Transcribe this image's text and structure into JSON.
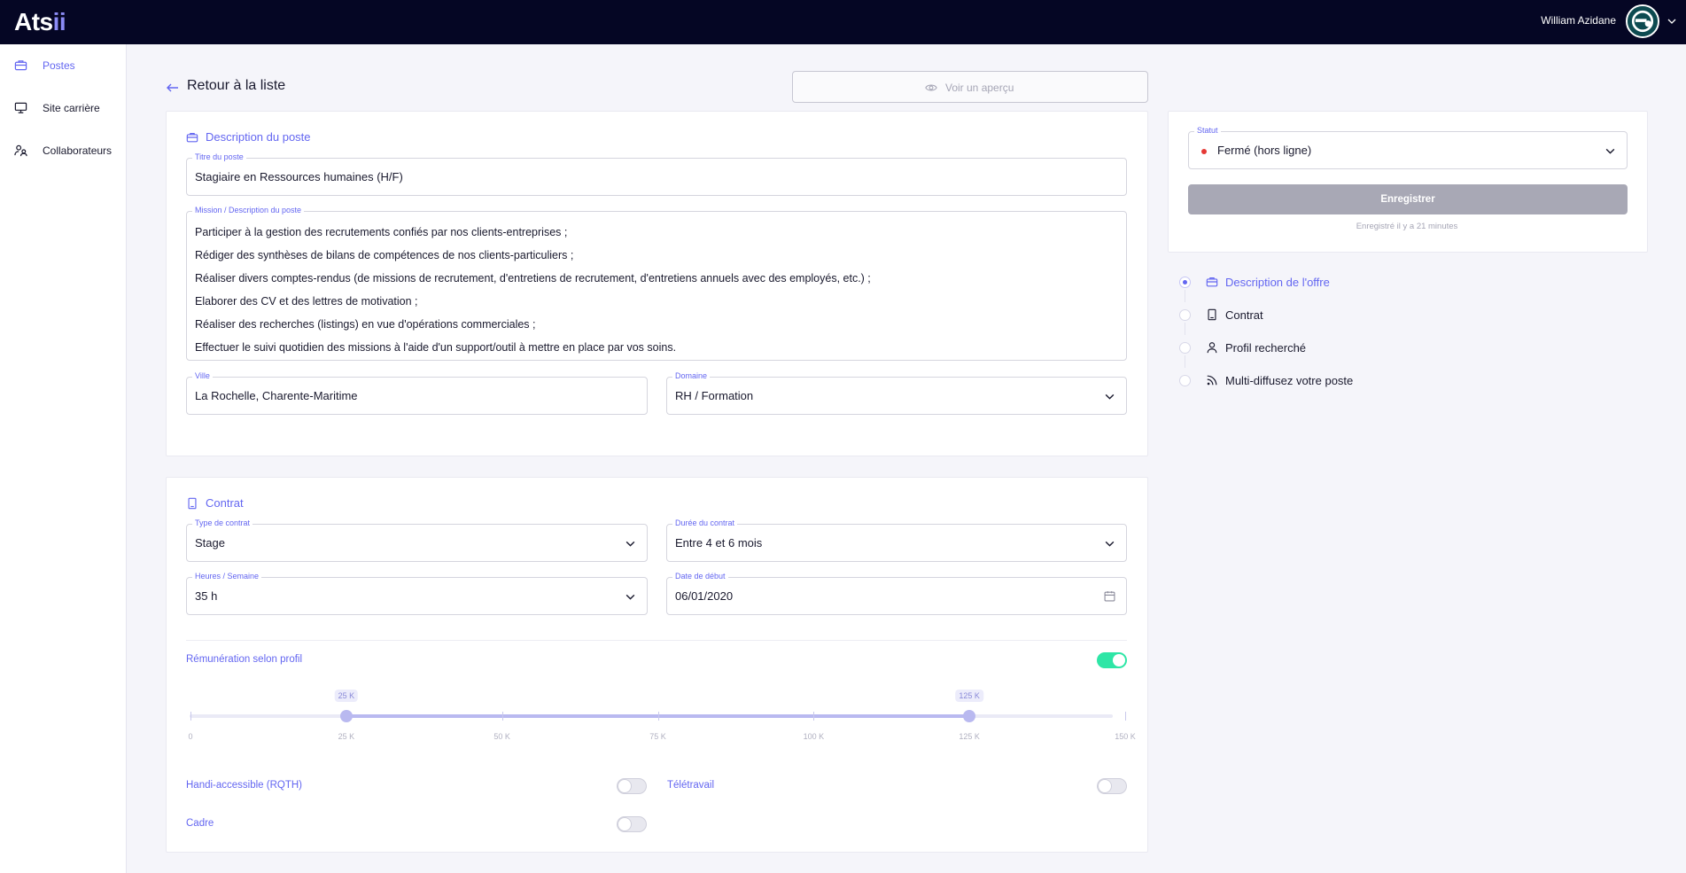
{
  "app": {
    "logo_main": "Ats",
    "logo_accent": "ii"
  },
  "user": {
    "name": "William Azidane"
  },
  "sidebar": {
    "items": [
      {
        "label": "Postes",
        "icon": "briefcase-icon",
        "active": true
      },
      {
        "label": "Site carrière",
        "icon": "monitor-icon",
        "active": false
      },
      {
        "label": "Collaborateurs",
        "icon": "users-icon",
        "active": false
      }
    ]
  },
  "header": {
    "back_label": "Retour à la liste",
    "preview_label": "Voir un aperçu"
  },
  "description": {
    "title": "Description du poste",
    "job_title_label": "Titre du poste",
    "job_title_value": "Stagiaire en Ressources humaines (H/F)",
    "mission_label": "Mission / Description du poste",
    "mission_lines": [
      "Participer à la gestion des recrutements confiés par nos clients-entreprises ;",
      "Rédiger des synthèses de bilans de compétences de nos clients-particuliers ;",
      "Réaliser divers comptes-rendus (de missions de recrutement, d'entretiens de recrutement, d'entretiens annuels avec des employés, etc.) ;",
      "Elaborer des CV et des lettres de motivation ;",
      "Réaliser des recherches (listings) en vue d'opérations commerciales ;",
      "Effectuer le suivi quotidien des missions à l'aide d'un support/outil à mettre en place par vos soins."
    ],
    "city_label": "Ville",
    "city_value": "La Rochelle, Charente-Maritime",
    "domain_label": "Domaine",
    "domain_value": "RH / Formation"
  },
  "contract": {
    "title": "Contrat",
    "type_label": "Type de contrat",
    "type_value": "Stage",
    "duration_label": "Durée du contrat",
    "duration_value": "Entre 4 et 6 mois",
    "hours_label": "Heures / Semaine",
    "hours_value": "35 h",
    "start_label": "Date de début",
    "start_value": "06/01/2020",
    "salary_label": "Rémunération selon profil",
    "salary_toggle_on": true,
    "salary_range": {
      "min": 0,
      "max": 150,
      "low": 25,
      "high": 125,
      "low_label": "25 K",
      "high_label": "125 K",
      "ticks": [
        {
          "value": 0,
          "label": "0"
        },
        {
          "value": 25,
          "label": "25 K"
        },
        {
          "value": 50,
          "label": "50 K"
        },
        {
          "value": 75,
          "label": "75 K"
        },
        {
          "value": 100,
          "label": "100 K"
        },
        {
          "value": 125,
          "label": "125 K"
        },
        {
          "value": 150,
          "label": "150 K"
        }
      ]
    },
    "handi_label": "Handi-accessible (RQTH)",
    "handi_on": false,
    "remote_label": "Télétravail",
    "remote_on": false,
    "cadre_label": "Cadre",
    "cadre_on": false
  },
  "status_panel": {
    "status_label": "Statut",
    "status_value": "Fermé (hors ligne)",
    "status_color": "#e53935",
    "save_label": "Enregistrer",
    "saved_note": "Enregistré il y a 21 minutes"
  },
  "steps": [
    {
      "label": "Description de l'offre",
      "icon": "briefcase-icon",
      "active": true
    },
    {
      "label": "Contrat",
      "icon": "document-icon",
      "active": false
    },
    {
      "label": "Profil recherché",
      "icon": "user-icon",
      "active": false
    },
    {
      "label": "Multi-diffusez votre poste",
      "icon": "broadcast-icon",
      "active": false
    }
  ],
  "colors": {
    "accent": "#6366f1",
    "topbar": "#050624",
    "toggle_on": "#2ee6a6"
  }
}
